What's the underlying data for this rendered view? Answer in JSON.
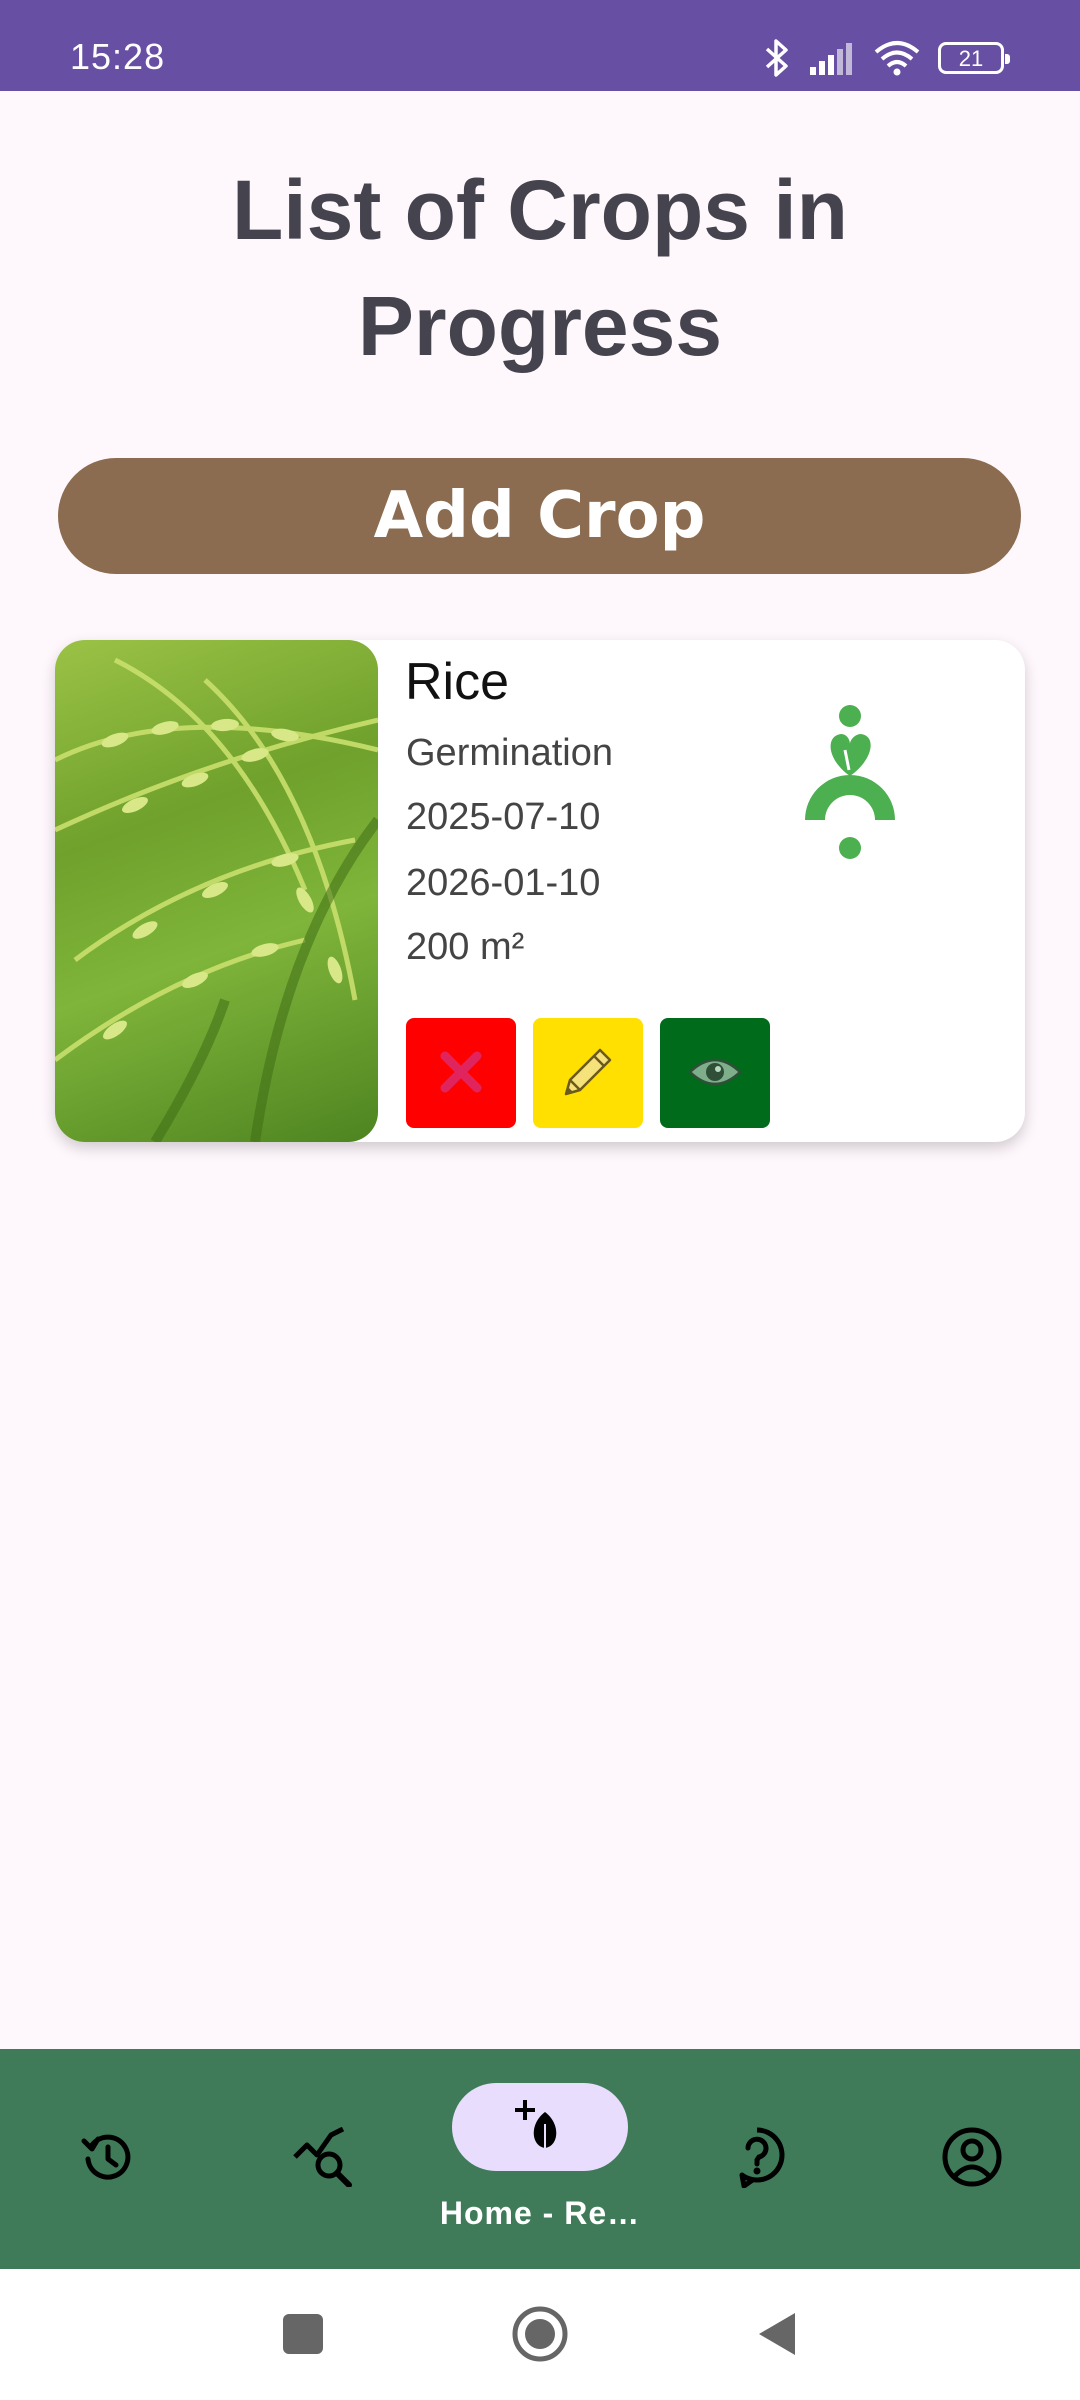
{
  "status_bar": {
    "time": "15:28",
    "battery": "21",
    "icons": [
      "bluetooth-icon",
      "signal-icon",
      "wifi-icon",
      "battery-icon"
    ]
  },
  "page": {
    "title": "List of Crops in Progress"
  },
  "add_button": {
    "label": "Add Crop"
  },
  "crops": [
    {
      "name": "Rice",
      "stage": "Germination",
      "start_date": "2025-07-10",
      "end_date": "2026-01-10",
      "area": "200 m²",
      "stage_icon": "germination-stage-icon",
      "actions": [
        "delete-icon",
        "edit-pencil-icon",
        "view-eye-icon"
      ]
    }
  ],
  "bottom_nav": {
    "items": [
      {
        "icon": "history-icon"
      },
      {
        "icon": "analysis-search-icon"
      },
      {
        "icon": "add-crop-leaf-icon",
        "label": "Home - Re…",
        "selected": true
      },
      {
        "icon": "help-icon"
      },
      {
        "icon": "profile-icon"
      }
    ]
  },
  "colors": {
    "status_bar": "#674FA3",
    "title": "#45434D",
    "add_button": "#8B6C50",
    "delete": "#FF0000",
    "edit": "#FFE000",
    "view": "#006B1A",
    "nav_bg": "#3F7B58",
    "nav_pill": "#E9DDFE",
    "stage_icon": "#4CAF50"
  }
}
